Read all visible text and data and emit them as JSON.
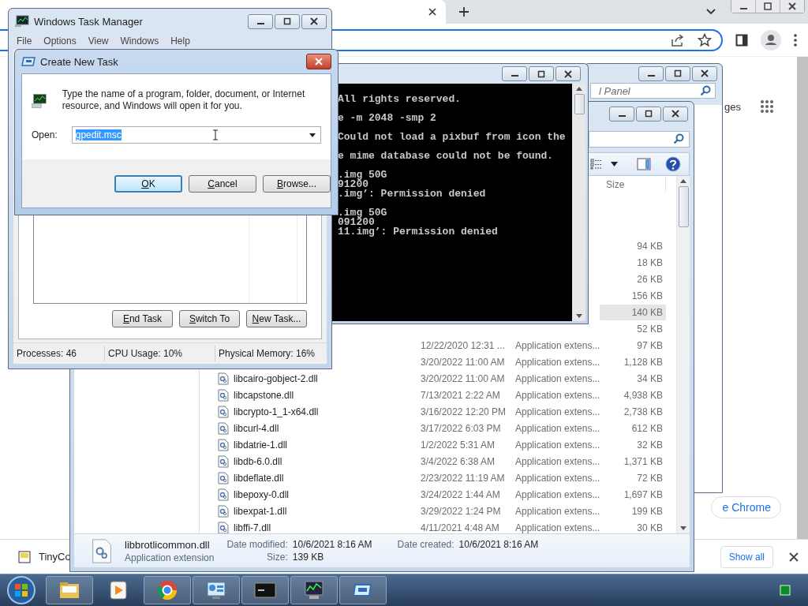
{
  "browser": {
    "partial_heading": "ges",
    "promo_button": "e Chrome",
    "download_item": "TinyCo",
    "show_all": "Show all"
  },
  "control_panel": {
    "search": {
      "placeholder": "l Panel"
    }
  },
  "explorer": {
    "columns": [
      "Size"
    ],
    "rows": [
      {
        "size": "94 KB",
        "selected": false
      },
      {
        "size": "18 KB",
        "selected": false
      },
      {
        "size": "26 KB",
        "selected": false
      },
      {
        "size": "156 KB",
        "selected": false
      },
      {
        "size": "140 KB",
        "selected": true
      },
      {
        "size": "52 KB",
        "selected": false
      },
      {
        "date": "12/22/2020 12:31 ...",
        "type": "Application extens...",
        "size": "97 KB",
        "selected": false
      },
      {
        "date": "3/20/2022 11:00 AM",
        "type": "Application extens...",
        "size": "1,128 KB",
        "selected": false
      },
      {
        "name": "libcairo-gobject-2.dll",
        "date": "3/20/2022 11:00 AM",
        "type": "Application extens...",
        "size": "34 KB",
        "selected": false
      },
      {
        "name": "libcapstone.dll",
        "date": "7/13/2021 2:22 AM",
        "type": "Application extens...",
        "size": "4,938 KB",
        "selected": false
      },
      {
        "name": "libcrypto-1_1-x64.dll",
        "date": "3/16/2022 12:20 PM",
        "type": "Application extens...",
        "size": "2,738 KB",
        "selected": false
      },
      {
        "name": "libcurl-4.dll",
        "date": "3/17/2022 6:03 PM",
        "type": "Application extens...",
        "size": "612 KB",
        "selected": false
      },
      {
        "name": "libdatrie-1.dll",
        "date": "1/2/2022 5:31 AM",
        "type": "Application extens...",
        "size": "32 KB",
        "selected": false
      },
      {
        "name": "libdb-6.0.dll",
        "date": "3/4/2022 6:38 AM",
        "type": "Application extens...",
        "size": "1,371 KB",
        "selected": false
      },
      {
        "name": "libdeflate.dll",
        "date": "2/23/2022 11:19 AM",
        "type": "Application extens...",
        "size": "72 KB",
        "selected": false
      },
      {
        "name": "libepoxy-0.dll",
        "date": "3/24/2022 1:44 AM",
        "type": "Application extens...",
        "size": "1,697 KB",
        "selected": false
      },
      {
        "name": "libexpat-1.dll",
        "date": "3/29/2022 1:24 PM",
        "type": "Application extens...",
        "size": "199 KB",
        "selected": false
      },
      {
        "name": "libffi-7.dll",
        "date": "4/11/2021 4:48 AM",
        "type": "Application extens...",
        "size": "30 KB",
        "selected": false
      }
    ],
    "details": {
      "name": "libbrotlicommon.dll",
      "type": "Application extension",
      "fields": [
        {
          "label": "Date modified:",
          "value": "10/6/2021 8:16 AM"
        },
        {
          "label": "Date created:",
          "value": "10/6/2021 8:16 AM"
        },
        {
          "label": "Size:",
          "value": "139 KB"
        }
      ]
    }
  },
  "console": {
    "blocks": [
      [
        "All rights reserved."
      ],
      [
        "e -m 2048 -smp 2"
      ],
      [
        "Could not load a pixbuf from icon the"
      ],
      [
        "e mime database could not be found."
      ],
      [
        ".img 50G",
        "91200",
        ".img’: Permission denied"
      ],
      [
        ".img 50G",
        "091200",
        "11.img’: Permission denied"
      ]
    ]
  },
  "task_manager": {
    "title": "Windows Task Manager",
    "menu": [
      "File",
      "Options",
      "View",
      "Windows",
      "Help"
    ],
    "buttons": [
      "End Task",
      "Switch To",
      "New Task..."
    ],
    "status": [
      "Processes: 46",
      "CPU Usage: 10%",
      "Physical Memory: 16%"
    ]
  },
  "dialog": {
    "title": "Create New Task",
    "message": "Type the name of a program, folder, document, or Internet resource, and Windows will open it for you.",
    "open_label": "Open:",
    "open_value": "gpedit.msc",
    "value_selected": true,
    "buttons": [
      {
        "label": "OK",
        "default": true
      },
      {
        "label": "Cancel",
        "default": false
      },
      {
        "label": "Browse...",
        "default": false
      }
    ]
  },
  "taskbar": {
    "items": [
      {
        "kind": "folder",
        "open": true
      },
      {
        "kind": "media",
        "open": false
      },
      {
        "kind": "chrome",
        "open": true
      },
      {
        "kind": "control-panel",
        "open": true
      },
      {
        "kind": "console",
        "open": true
      },
      {
        "kind": "task-manager",
        "open": true
      },
      {
        "kind": "dialog",
        "open": true
      }
    ]
  }
}
